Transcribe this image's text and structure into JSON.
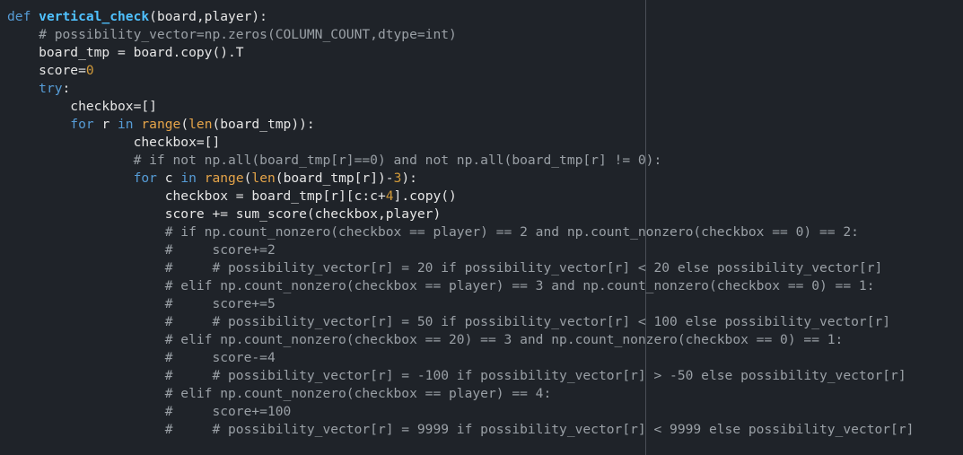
{
  "editor": {
    "theme_colors": {
      "background": "#1f2329",
      "keyword": "#569cd6",
      "function_name": "#4fc1ff",
      "builtin": "#e5a449",
      "number": "#d19a3a",
      "comment": "#9aa0a6",
      "text": "#e6e6e6"
    },
    "lines": [
      [
        {
          "t": "def ",
          "c": "kw"
        },
        {
          "t": "vertical_check",
          "c": "fn"
        },
        {
          "t": "(board,player):",
          "c": "tx"
        }
      ],
      [
        {
          "t": "    # possibility_vector=np.zeros(COLUMN_COUNT,dtype=int)",
          "c": "cm"
        }
      ],
      [
        {
          "t": "    board_tmp = board.copy().T",
          "c": "tx"
        }
      ],
      [
        {
          "t": "    score=",
          "c": "tx"
        },
        {
          "t": "0",
          "c": "num"
        }
      ],
      [
        {
          "t": "    ",
          "c": "tx"
        },
        {
          "t": "try",
          "c": "kw"
        },
        {
          "t": ":",
          "c": "tx"
        }
      ],
      [
        {
          "t": "        checkbox=[]",
          "c": "tx"
        }
      ],
      [
        {
          "t": "        ",
          "c": "tx"
        },
        {
          "t": "for",
          "c": "kw"
        },
        {
          "t": " r ",
          "c": "tx"
        },
        {
          "t": "in",
          "c": "kw"
        },
        {
          "t": " ",
          "c": "tx"
        },
        {
          "t": "range",
          "c": "bi"
        },
        {
          "t": "(",
          "c": "tx"
        },
        {
          "t": "len",
          "c": "bi"
        },
        {
          "t": "(board_tmp)):",
          "c": "tx"
        }
      ],
      [
        {
          "t": "                checkbox=[]",
          "c": "tx"
        }
      ],
      [
        {
          "t": "                # if not np.all(board_tmp[r]==0) and not np.all(board_tmp[r] != 0):",
          "c": "cm"
        }
      ],
      [
        {
          "t": "                ",
          "c": "tx"
        },
        {
          "t": "for",
          "c": "kw"
        },
        {
          "t": " c ",
          "c": "tx"
        },
        {
          "t": "in",
          "c": "kw"
        },
        {
          "t": " ",
          "c": "tx"
        },
        {
          "t": "range",
          "c": "bi"
        },
        {
          "t": "(",
          "c": "tx"
        },
        {
          "t": "len",
          "c": "bi"
        },
        {
          "t": "(board_tmp[r])-",
          "c": "tx"
        },
        {
          "t": "3",
          "c": "num"
        },
        {
          "t": "):",
          "c": "tx"
        }
      ],
      [
        {
          "t": "                    checkbox = board_tmp[r][c:c+",
          "c": "tx"
        },
        {
          "t": "4",
          "c": "num"
        },
        {
          "t": "].copy()",
          "c": "tx"
        }
      ],
      [
        {
          "t": "                    score += sum_score(checkbox,player)",
          "c": "tx"
        }
      ],
      [
        {
          "t": "                    # if np.count_nonzero(checkbox == player) == 2 and np.count_nonzero(checkbox == 0) == 2:",
          "c": "cm"
        }
      ],
      [
        {
          "t": "                    #     score+=2",
          "c": "cm"
        }
      ],
      [
        {
          "t": "                    #     # possibility_vector[r] = 20 if possibility_vector[r] < 20 else possibility_vector[r]",
          "c": "cm"
        }
      ],
      [
        {
          "t": "                    # elif np.count_nonzero(checkbox == player) == 3 and np.count_nonzero(checkbox == 0) == 1:",
          "c": "cm"
        }
      ],
      [
        {
          "t": "                    #     score+=5",
          "c": "cm"
        }
      ],
      [
        {
          "t": "                    #     # possibility_vector[r] = 50 if possibility_vector[r] < 100 else possibility_vector[r]",
          "c": "cm"
        }
      ],
      [
        {
          "t": "                    # elif np.count_nonzero(checkbox == 20) == 3 and np.count_nonzero(checkbox == 0) == 1:",
          "c": "cm"
        }
      ],
      [
        {
          "t": "                    #     score-=4",
          "c": "cm"
        }
      ],
      [
        {
          "t": "                    #     # possibility_vector[r] = -100 if possibility_vector[r] > -50 else possibility_vector[r]",
          "c": "cm"
        }
      ],
      [
        {
          "t": "                    # elif np.count_nonzero(checkbox == player) == 4:",
          "c": "cm"
        }
      ],
      [
        {
          "t": "                    #     score+=100",
          "c": "cm"
        }
      ],
      [
        {
          "t": "                    #     # possibility_vector[r] = 9999 if possibility_vector[r] < 9999 else possibility_vector[r]",
          "c": "cm"
        }
      ]
    ]
  }
}
